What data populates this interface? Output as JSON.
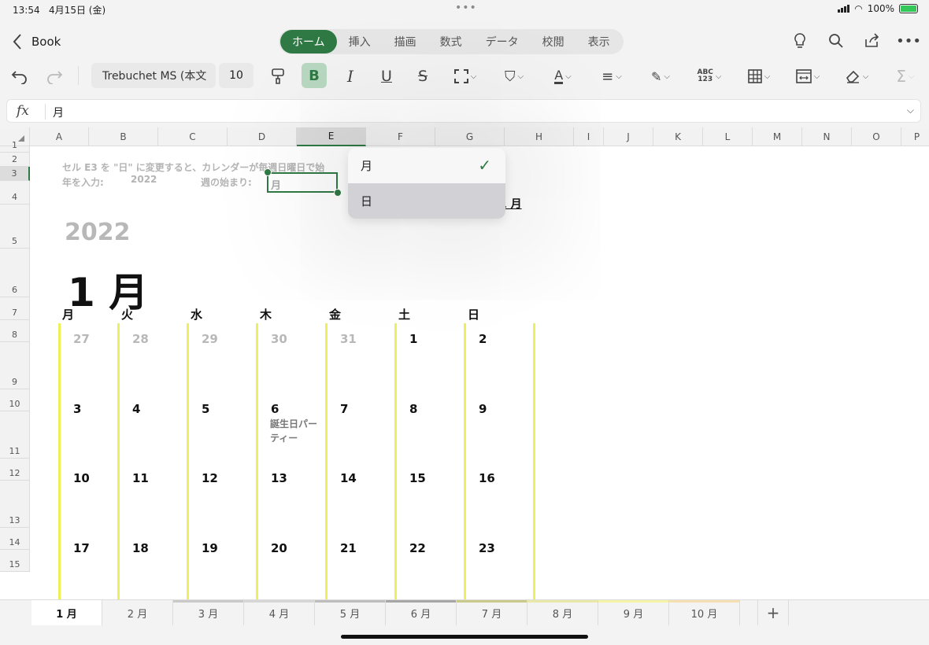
{
  "status": {
    "time": "13:54",
    "date": "4月15日 (金)",
    "battery": "100%"
  },
  "topbar": {
    "back_label": "Book",
    "tabs": [
      {
        "label": "ホーム",
        "active": true
      },
      {
        "label": "挿入"
      },
      {
        "label": "描画"
      },
      {
        "label": "数式"
      },
      {
        "label": "データ"
      },
      {
        "label": "校閲"
      },
      {
        "label": "表示"
      }
    ],
    "icons": [
      "lightbulb-icon",
      "search-icon",
      "share-icon",
      "more-icon"
    ]
  },
  "ribbon": {
    "font_name": "Trebuchet MS (本文",
    "font_size": "10",
    "bold_label": "B",
    "italic_label": "I",
    "underline_label": "U",
    "strike_label": "S",
    "spell_label": "ABC\n123",
    "sum_label": "Σ"
  },
  "formula_bar": {
    "fx_label": "fx",
    "value": "月"
  },
  "columns": [
    "A",
    "B",
    "C",
    "D",
    "E",
    "F",
    "G",
    "H",
    "I",
    "J",
    "K",
    "L",
    "M",
    "N",
    "O",
    "P"
  ],
  "selected_column": "E",
  "rows": [
    "1",
    "2",
    "3",
    "4",
    "5",
    "6",
    "7",
    "8",
    "9",
    "10",
    "11",
    "12",
    "13",
    "14",
    "15"
  ],
  "selected_row": "3",
  "sheet": {
    "hint_text": "セル E3 を \"日\" に変更すると、カレンダーが毎週日曜日で始",
    "year_prompt": "年を入力:",
    "year_value": "2022",
    "week_start_prompt": "週の始まり:",
    "week_start_value": "月",
    "link_month_fragment": "1 月",
    "year_big": "2022",
    "month_big": "1 月",
    "weekdays": [
      "月",
      "火",
      "水",
      "木",
      "金",
      "土",
      "日"
    ],
    "weeks": [
      [
        "27",
        "28",
        "29",
        "30",
        "31",
        "1",
        "2"
      ],
      [
        "3",
        "4",
        "5",
        "6",
        "7",
        "8",
        "9"
      ],
      [
        "10",
        "11",
        "12",
        "13",
        "14",
        "15",
        "16"
      ],
      [
        "17",
        "18",
        "19",
        "20",
        "21",
        "22",
        "23"
      ]
    ],
    "event_text": "誕生日パーティー"
  },
  "dropdown": {
    "options": [
      {
        "label": "月",
        "checked": true
      },
      {
        "label": "日",
        "highlighted": true
      }
    ]
  },
  "sheet_tabs": [
    {
      "label": "1 月",
      "active": true,
      "color": "#ffffff"
    },
    {
      "label": "2 月",
      "color": "#f3f3f3"
    },
    {
      "label": "3 月",
      "color": "#c9c9c9"
    },
    {
      "label": "4 月",
      "color": "#d6d6d6"
    },
    {
      "label": "5 月",
      "color": "#bdbdbd"
    },
    {
      "label": "6 月",
      "color": "#a6a6a6"
    },
    {
      "label": "7 月",
      "color": "#c8c98a"
    },
    {
      "label": "8 月",
      "color": "#e8e9a8"
    },
    {
      "label": "9 月",
      "color": "#f4f3a6"
    },
    {
      "label": "10 月",
      "color": "#f5dfb3"
    }
  ],
  "add_sheet_label": "+"
}
